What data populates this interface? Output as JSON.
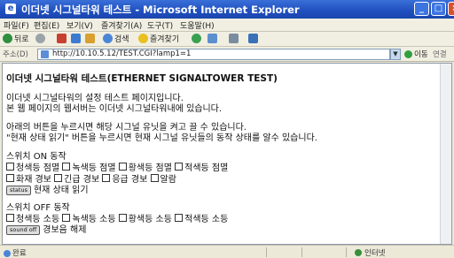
{
  "window": {
    "title": "이더넷 시그널타워 테스트 - Microsoft Internet Explorer",
    "title_color": "#1f4fbf"
  },
  "menubar": {
    "items": [
      "파일(F)",
      "편집(E)",
      "보기(V)",
      "즐겨찾기(A)",
      "도구(T)",
      "도움말(H)"
    ]
  },
  "toolbar": {
    "back_label": "뒤로",
    "search_label": "검색",
    "favorites_label": "즐겨찾기"
  },
  "address": {
    "label": "주소(D)",
    "url": "http://10.10.5.12/TEST.CGI?lamp1=1",
    "go_label": "이동",
    "links_label": "연결"
  },
  "page": {
    "heading": "이더넷 시그널타워 테스트(ETHERNET SIGNALTOWER TEST)",
    "intro_1": "이더넷 시그널타워의 설정 테스트 페이지입니다.",
    "intro_2": "본 웹 페이지의 웹서버는 이더넷 시그널타워내에 있습니다.",
    "guide_1": "아래의 버튼을 누르시면 해당 시그널 유닛을 켜고 끌 수 있습니다.",
    "guide_2": "\"현재 상태 읽기\" 버튼을 누르시면 현재 시그널 유닛들의 동작 상태를 알수 있습니다.",
    "on_section": {
      "title": "스위치 ON 동작",
      "row1": [
        "청색등 점멸",
        "녹색등 점멸",
        "황색등 점멸",
        "적색등 점멸"
      ],
      "row2": [
        "화재 경보",
        "긴급 경보",
        "응급 경보",
        "알람"
      ],
      "status_button": "status",
      "status_text": "현재 상태 읽기"
    },
    "off_section": {
      "title": "스위치 OFF 동작",
      "row1": [
        "청색등 소등",
        "녹색등 소등",
        "황색등 소등",
        "적색등 소등"
      ],
      "sound_button": "sound off",
      "sound_text": "경보음 해제"
    }
  },
  "statusbar": {
    "left": "완료",
    "zone": "인터넷"
  }
}
